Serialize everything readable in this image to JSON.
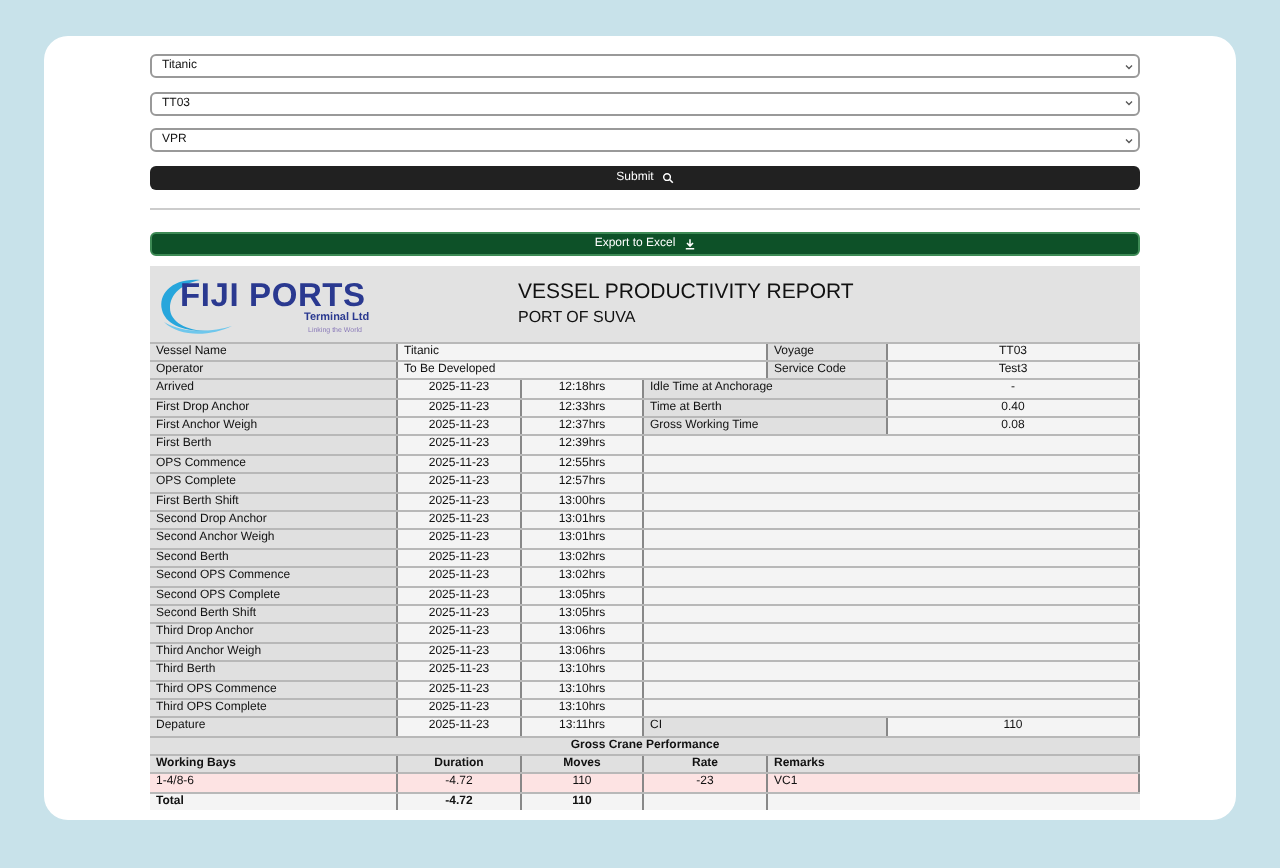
{
  "form": {
    "selects": [
      {
        "value": "Titanic"
      },
      {
        "value": "TT03"
      },
      {
        "value": "VPR"
      }
    ],
    "submit": "Submit",
    "export": "Export to Excel"
  },
  "report": {
    "logo": {
      "name": "FIJI PORTS",
      "subtitle": "Terminal Ltd",
      "tagline": "Linking the World"
    },
    "title": "VESSEL PRODUCTIVITY REPORT",
    "subtitle": "PORT OF SUVA",
    "vessel_info": [
      {
        "label": "Vessel Name",
        "value": "Titanic",
        "label2": "Voyage",
        "value2": "TT03"
      },
      {
        "label": "Operator",
        "value": "To Be Developed",
        "label2": "Service Code",
        "value2": "Test3"
      }
    ],
    "events": [
      {
        "label": "Arrived",
        "date": "2025-11-23",
        "time": "12:18hrs",
        "side_label": "Idle Time at Anchorage",
        "side_value": "-"
      },
      {
        "label": "First Drop Anchor",
        "date": "2025-11-23",
        "time": "12:33hrs",
        "side_label": "Time at Berth",
        "side_value": "0.40"
      },
      {
        "label": "First Anchor Weigh",
        "date": "2025-11-23",
        "time": "12:37hrs",
        "side_label": "Gross Working Time",
        "side_value": "0.08"
      },
      {
        "label": "First Berth",
        "date": "2025-11-23",
        "time": "12:39hrs"
      },
      {
        "label": "OPS Commence",
        "date": "2025-11-23",
        "time": "12:55hrs"
      },
      {
        "label": "OPS Complete",
        "date": "2025-11-23",
        "time": "12:57hrs"
      },
      {
        "label": "First Berth Shift",
        "date": "2025-11-23",
        "time": "13:00hrs"
      },
      {
        "label": "Second Drop Anchor",
        "date": "2025-11-23",
        "time": "13:01hrs"
      },
      {
        "label": "Second Anchor Weigh",
        "date": "2025-11-23",
        "time": "13:01hrs"
      },
      {
        "label": "Second Berth",
        "date": "2025-11-23",
        "time": "13:02hrs"
      },
      {
        "label": "Second OPS Commence",
        "date": "2025-11-23",
        "time": "13:02hrs"
      },
      {
        "label": "Second OPS Complete",
        "date": "2025-11-23",
        "time": "13:05hrs"
      },
      {
        "label": "Second Berth Shift",
        "date": "2025-11-23",
        "time": "13:05hrs"
      },
      {
        "label": "Third Drop Anchor",
        "date": "2025-11-23",
        "time": "13:06hrs"
      },
      {
        "label": "Third Anchor Weigh",
        "date": "2025-11-23",
        "time": "13:06hrs"
      },
      {
        "label": "Third Berth",
        "date": "2025-11-23",
        "time": "13:10hrs"
      },
      {
        "label": "Third OPS Commence",
        "date": "2025-11-23",
        "time": "13:10hrs"
      },
      {
        "label": "Third OPS Complete",
        "date": "2025-11-23",
        "time": "13:10hrs"
      },
      {
        "label": "Depature",
        "date": "2025-11-23",
        "time": "13:11hrs",
        "side_label": "CI",
        "side_value": "110"
      }
    ],
    "crane": {
      "title": "Gross Crane Performance",
      "columns": [
        "Working Bays",
        "Duration",
        "Moves",
        "Rate",
        "Remarks"
      ],
      "rows": [
        {
          "cells": [
            "1-4/8-6",
            "-4.72",
            "110",
            "-23",
            "VC1"
          ],
          "highlighted": true
        },
        {
          "cells": [
            "Total",
            "-4.72",
            "110"
          ],
          "highlighted": false
        }
      ]
    }
  }
}
